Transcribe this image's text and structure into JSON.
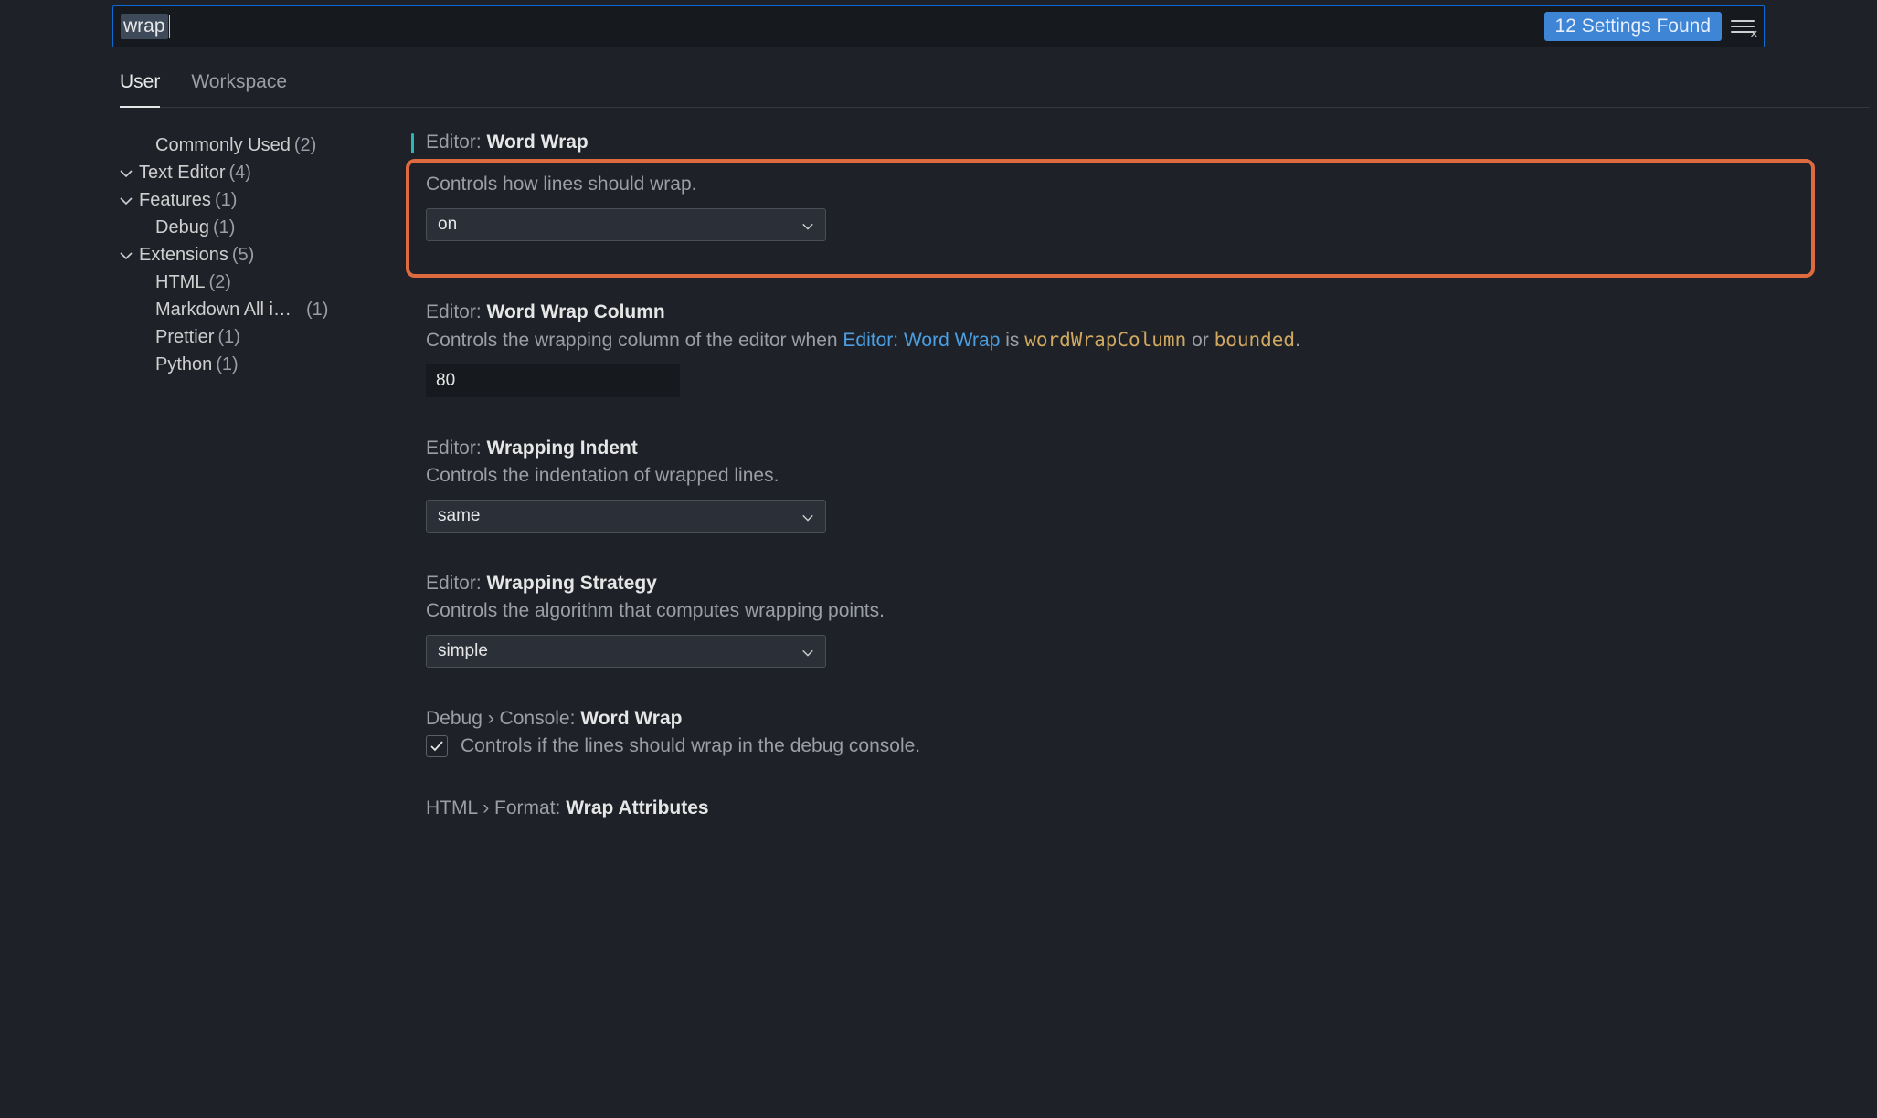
{
  "search": {
    "value": "wrap",
    "results_label": "12 Settings Found"
  },
  "tabs": {
    "user": "User",
    "workspace": "Workspace"
  },
  "tree": [
    {
      "label": "Commonly Used",
      "count": "(2)",
      "expandable": false,
      "indent": 1
    },
    {
      "label": "Text Editor",
      "count": "(4)",
      "expandable": true,
      "indent": 0
    },
    {
      "label": "Features",
      "count": "(1)",
      "expandable": true,
      "indent": 0
    },
    {
      "label": "Debug",
      "count": "(1)",
      "expandable": false,
      "indent": 1
    },
    {
      "label": "Extensions",
      "count": "(5)",
      "expandable": true,
      "indent": 0
    },
    {
      "label": "HTML",
      "count": "(2)",
      "expandable": false,
      "indent": 1
    },
    {
      "label": "Markdown All i…",
      "count": "(1)",
      "expandable": false,
      "indent": 1
    },
    {
      "label": "Prettier",
      "count": "(1)",
      "expandable": false,
      "indent": 1
    },
    {
      "label": "Python",
      "count": "(1)",
      "expandable": false,
      "indent": 1
    }
  ],
  "settings": {
    "word_wrap": {
      "prefix": "Editor: ",
      "title": "Word Wrap",
      "desc": "Controls how lines should wrap.",
      "value": "on"
    },
    "word_wrap_column": {
      "prefix": "Editor: ",
      "title": "Word Wrap Column",
      "desc_a": "Controls the wrapping column of the editor when ",
      "desc_link": "Editor: Word Wrap",
      "desc_b": " is ",
      "mono1": "wordWrapColumn",
      "desc_c": " or ",
      "mono2": "bounded",
      "desc_d": ".",
      "value": "80"
    },
    "wrapping_indent": {
      "prefix": "Editor: ",
      "title": "Wrapping Indent",
      "desc": "Controls the indentation of wrapped lines.",
      "value": "same"
    },
    "wrapping_strategy": {
      "prefix": "Editor: ",
      "title": "Wrapping Strategy",
      "desc": "Controls the algorithm that computes wrapping points.",
      "value": "simple"
    },
    "debug_console_wrap": {
      "prefix": "Debug › Console: ",
      "title": "Word Wrap",
      "desc": "Controls if the lines should wrap in the debug console.",
      "checked": true
    },
    "html_wrap_attributes": {
      "prefix": "HTML › Format: ",
      "title": "Wrap Attributes"
    }
  }
}
